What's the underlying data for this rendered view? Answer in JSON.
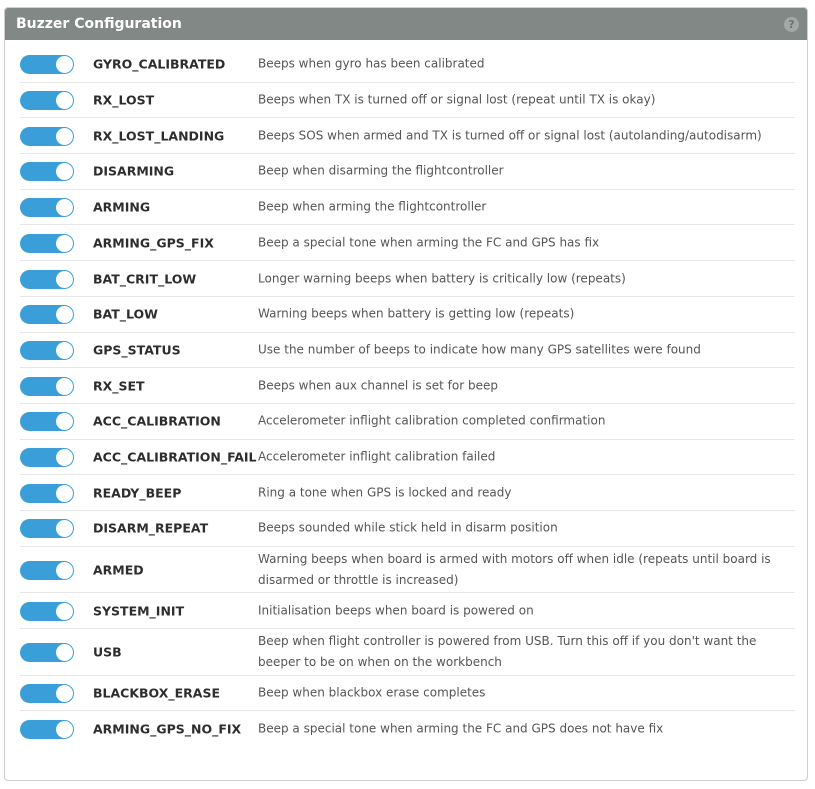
{
  "panel": {
    "title": "Buzzer Configuration",
    "help_icon": "?"
  },
  "colors": {
    "header_bg": "#828885",
    "toggle_on": "#3a9fd9"
  },
  "flags": [
    {
      "name": "GYRO_CALIBRATED",
      "description": "Beeps when gyro has been calibrated",
      "enabled": true
    },
    {
      "name": "RX_LOST",
      "description": "Beeps when TX is turned off or signal lost (repeat until TX is okay)",
      "enabled": true
    },
    {
      "name": "RX_LOST_LANDING",
      "description": "Beeps SOS when armed and TX is turned off or signal lost (autolanding/autodisarm)",
      "enabled": true
    },
    {
      "name": "DISARMING",
      "description": "Beep when disarming the flightcontroller",
      "enabled": true
    },
    {
      "name": "ARMING",
      "description": "Beep when arming the flightcontroller",
      "enabled": true
    },
    {
      "name": "ARMING_GPS_FIX",
      "description": "Beep a special tone when arming the FC and GPS has fix",
      "enabled": true
    },
    {
      "name": "BAT_CRIT_LOW",
      "description": "Longer warning beeps when battery is critically low (repeats)",
      "enabled": true
    },
    {
      "name": "BAT_LOW",
      "description": "Warning beeps when battery is getting low (repeats)",
      "enabled": true
    },
    {
      "name": "GPS_STATUS",
      "description": "Use the number of beeps to indicate how many GPS satellites were found",
      "enabled": true
    },
    {
      "name": "RX_SET",
      "description": "Beeps when aux channel is set for beep",
      "enabled": true
    },
    {
      "name": "ACC_CALIBRATION",
      "description": "Accelerometer inflight calibration completed confirmation",
      "enabled": true
    },
    {
      "name": "ACC_CALIBRATION_FAIL",
      "description": "Accelerometer inflight calibration failed",
      "enabled": true
    },
    {
      "name": "READY_BEEP",
      "description": "Ring a tone when GPS is locked and ready",
      "enabled": true
    },
    {
      "name": "DISARM_REPEAT",
      "description": "Beeps sounded while stick held in disarm position",
      "enabled": true
    },
    {
      "name": "ARMED",
      "description": "Warning beeps when board is armed with motors off when idle (repeats until board is disarmed or throttle is increased)",
      "enabled": true
    },
    {
      "name": "SYSTEM_INIT",
      "description": "Initialisation beeps when board is powered on",
      "enabled": true
    },
    {
      "name": "USB",
      "description": "Beep when flight controller is powered from USB. Turn this off if you don't want the beeper to be on when on the workbench",
      "enabled": true
    },
    {
      "name": "BLACKBOX_ERASE",
      "description": "Beep when blackbox erase completes",
      "enabled": true
    },
    {
      "name": "ARMING_GPS_NO_FIX",
      "description": "Beep a special tone when arming the FC and GPS does not have fix",
      "enabled": true
    }
  ]
}
